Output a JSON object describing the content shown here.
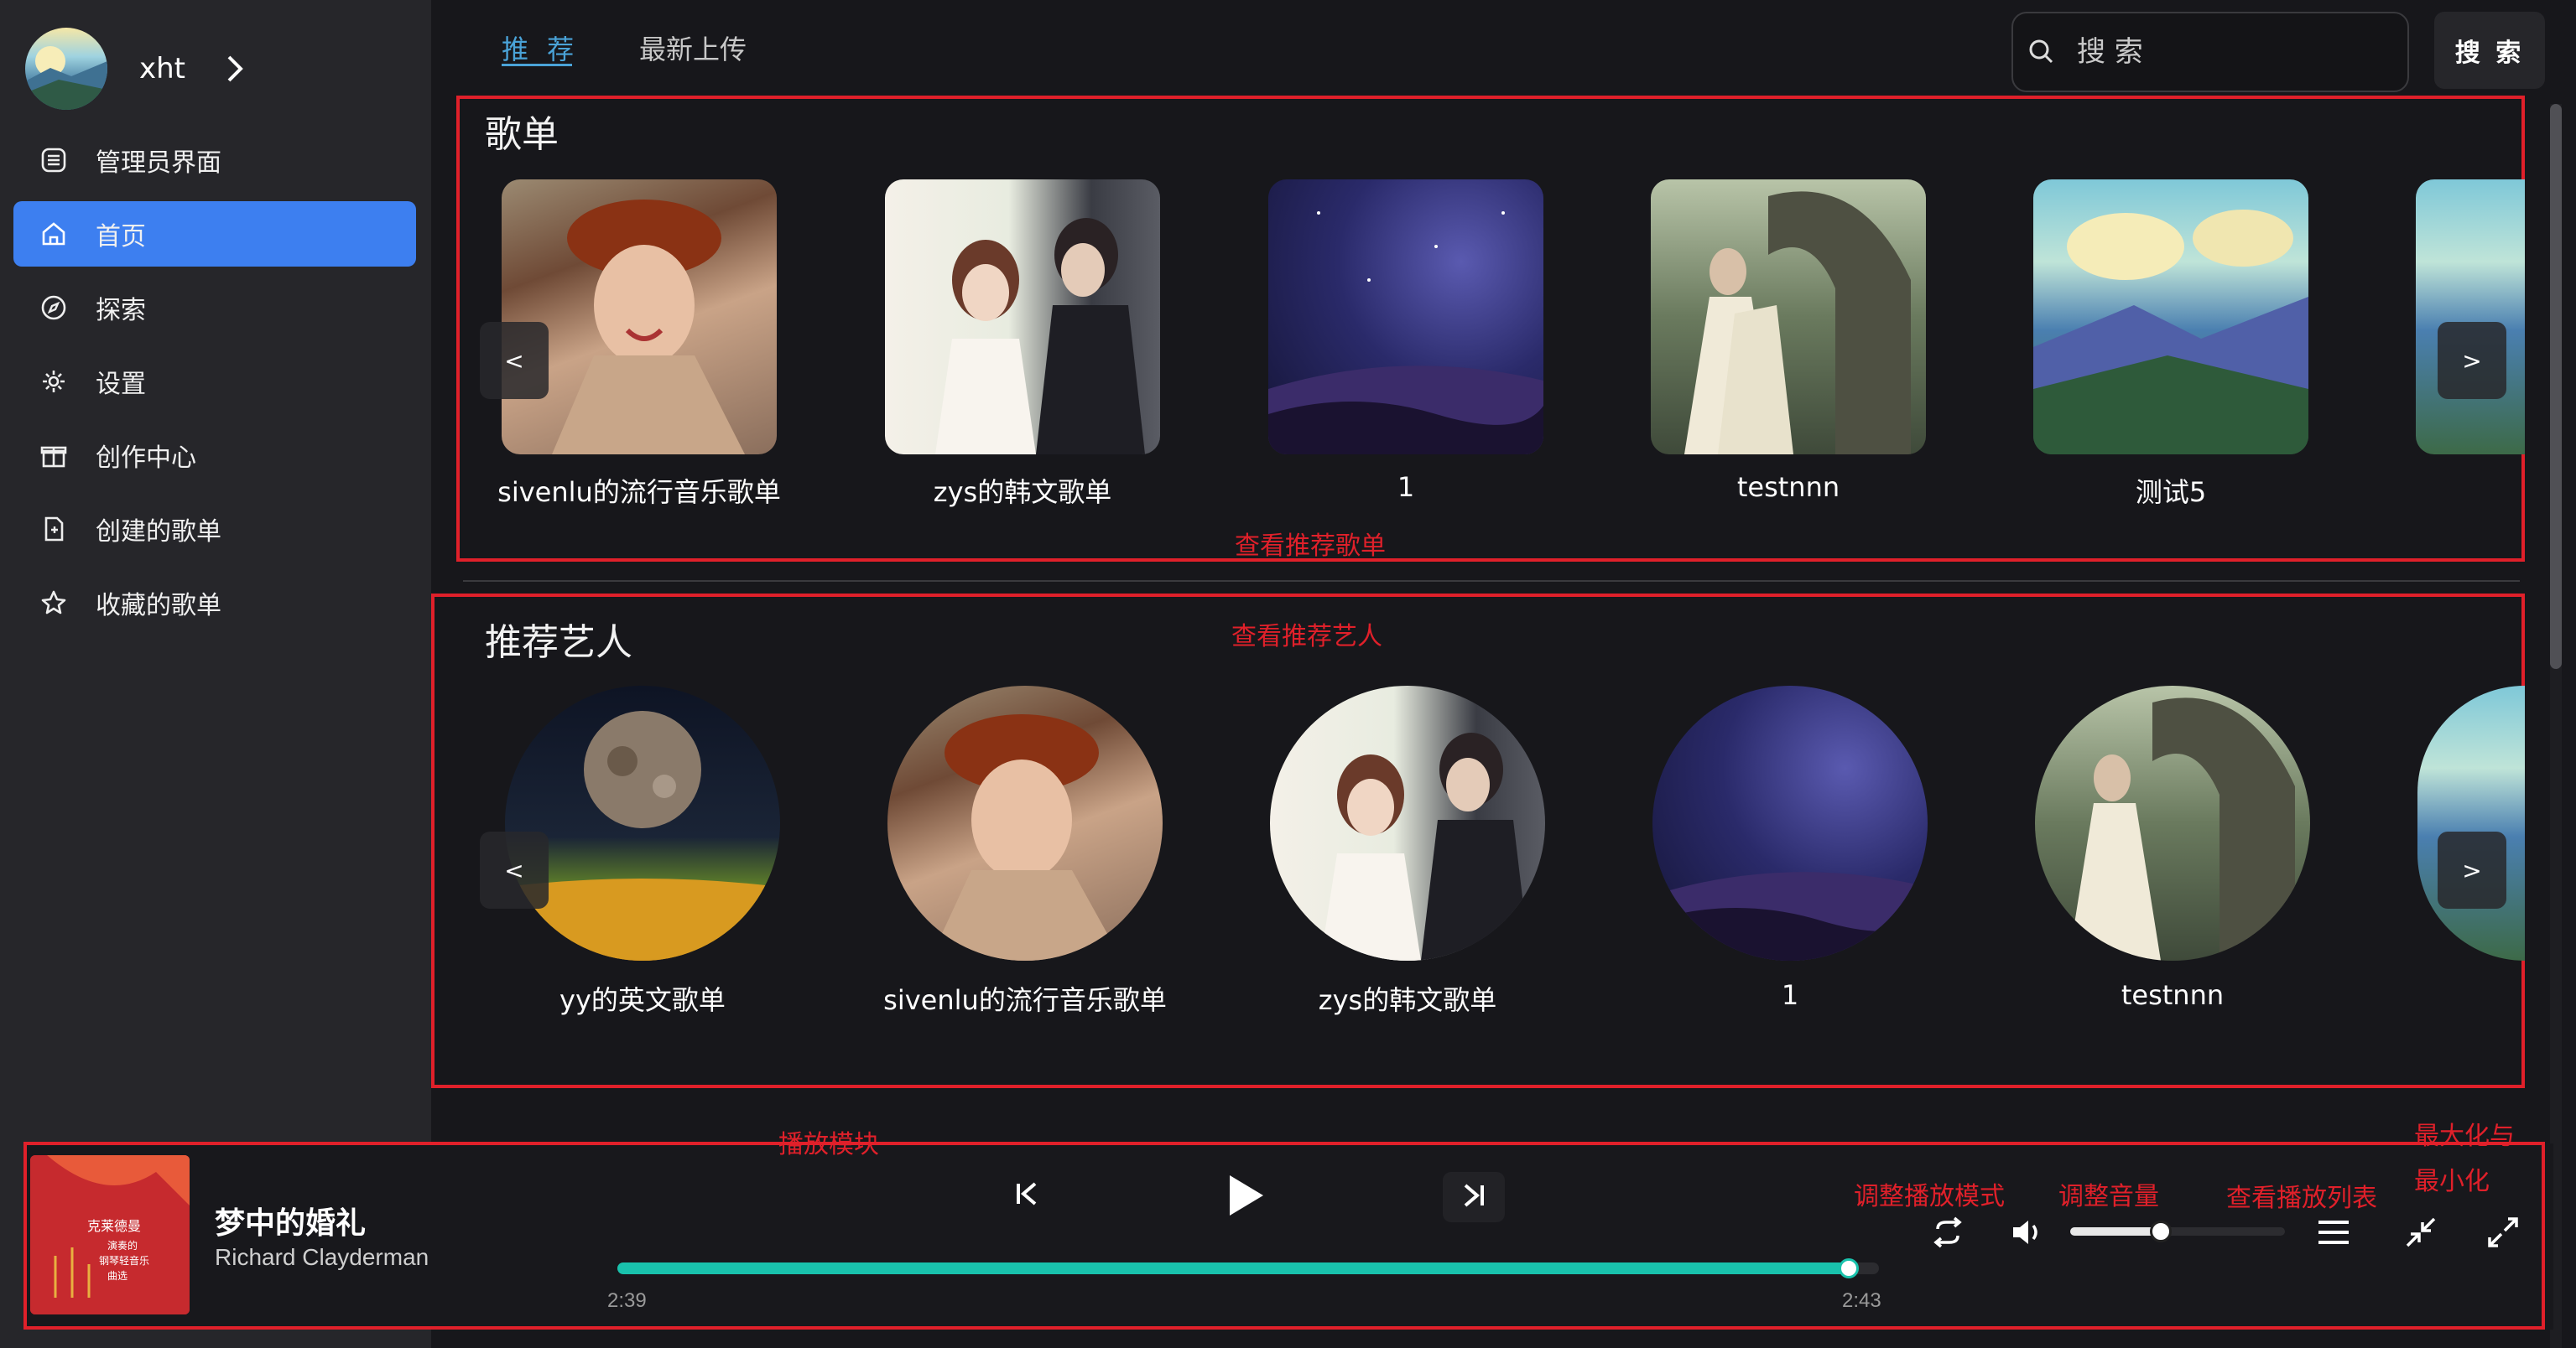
{
  "user": {
    "name": "xht"
  },
  "sidebar": {
    "items": [
      {
        "label": "管理员界面",
        "icon": "admin-list-icon",
        "active": false
      },
      {
        "label": "首页",
        "icon": "home-icon",
        "active": true
      },
      {
        "label": "探索",
        "icon": "compass-icon",
        "active": false
      },
      {
        "label": "设置",
        "icon": "gear-icon",
        "active": false
      },
      {
        "label": "创作中心",
        "icon": "gift-icon",
        "active": false
      },
      {
        "label": "创建的歌单",
        "icon": "document-icon",
        "active": false
      },
      {
        "label": "收藏的歌单",
        "icon": "star-icon",
        "active": false
      }
    ]
  },
  "tabs": [
    {
      "label": "推 荐",
      "active": true
    },
    {
      "label": "最新上传",
      "active": false
    }
  ],
  "search": {
    "placeholder": "搜 索",
    "button_label": "搜 索"
  },
  "playlists": {
    "title": "歌单",
    "items": [
      {
        "name": "sivenlu的流行音乐歌单"
      },
      {
        "name": "zys的韩文歌单"
      },
      {
        "name": "1"
      },
      {
        "name": "testnnn"
      },
      {
        "name": "测试5"
      }
    ]
  },
  "artists": {
    "title": "推荐艺人",
    "items": [
      {
        "name": "yy的英文歌单"
      },
      {
        "name": "sivenlu的流行音乐歌单"
      },
      {
        "name": "zys的韩文歌单"
      },
      {
        "name": "1"
      },
      {
        "name": "testnnn"
      }
    ]
  },
  "annotations": {
    "playlist_box": "查看推荐歌单",
    "artist_box": "查看推荐艺人",
    "player_box": "播放模块",
    "play_mode": "调整播放模式",
    "volume": "调整音量",
    "playlist_view": "查看播放列表",
    "window_line1": "最大化与",
    "window_line2": "最小化"
  },
  "player": {
    "song": "梦中的婚礼",
    "artist": "Richard Clayderman",
    "current_time": "2:39",
    "total_time": "2:43",
    "progress": 0.976,
    "volume": 0.42,
    "cover_text": "克莱德曼 演奏的 钢琴轻音乐 曲选"
  },
  "colors": {
    "accent": "#3d7ff0",
    "tab_active": "#4aa3d8",
    "progress": "#19c2ac",
    "annotation": "#e0202a"
  }
}
